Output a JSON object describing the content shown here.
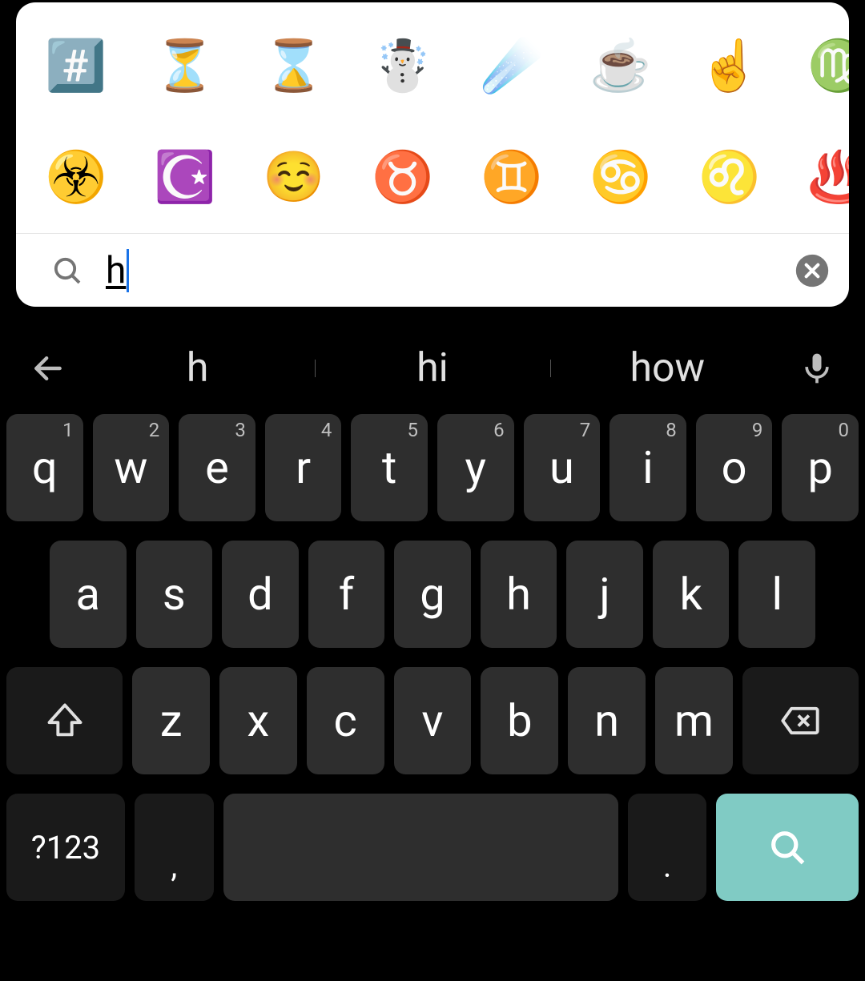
{
  "emoji": {
    "rows": [
      [
        {
          "name": "keycap-hash",
          "glyph": "#️⃣"
        },
        {
          "name": "hourglass-flowing",
          "glyph": "⏳"
        },
        {
          "name": "hourglass-done",
          "glyph": "⌛"
        },
        {
          "name": "snowman",
          "glyph": "☃️"
        },
        {
          "name": "comet",
          "glyph": "☄️"
        },
        {
          "name": "hot-beverage",
          "glyph": "☕"
        },
        {
          "name": "index-pointing-up",
          "glyph": "☝️"
        },
        {
          "name": "virgo",
          "glyph": "♍"
        }
      ],
      [
        {
          "name": "biohazard",
          "glyph": "☣️"
        },
        {
          "name": "star-and-crescent",
          "glyph": "☪️"
        },
        {
          "name": "smiling-face",
          "glyph": "☺️"
        },
        {
          "name": "taurus",
          "glyph": "♉"
        },
        {
          "name": "gemini",
          "glyph": "♊"
        },
        {
          "name": "cancer",
          "glyph": "♋"
        },
        {
          "name": "leo",
          "glyph": "♌"
        },
        {
          "name": "hot-springs",
          "glyph": "♨️"
        }
      ]
    ]
  },
  "search": {
    "value": "h"
  },
  "suggestions": [
    "h",
    "hi",
    "how"
  ],
  "keyboard": {
    "row1": [
      {
        "k": "q",
        "h": "1"
      },
      {
        "k": "w",
        "h": "2"
      },
      {
        "k": "e",
        "h": "3"
      },
      {
        "k": "r",
        "h": "4"
      },
      {
        "k": "t",
        "h": "5"
      },
      {
        "k": "y",
        "h": "6"
      },
      {
        "k": "u",
        "h": "7"
      },
      {
        "k": "i",
        "h": "8"
      },
      {
        "k": "o",
        "h": "9"
      },
      {
        "k": "p",
        "h": "0"
      }
    ],
    "row2": [
      "a",
      "s",
      "d",
      "f",
      "g",
      "h",
      "j",
      "k",
      "l"
    ],
    "row3": [
      "z",
      "x",
      "c",
      "v",
      "b",
      "n",
      "m"
    ],
    "symbols_label": "?123",
    "comma": ",",
    "period": "."
  }
}
